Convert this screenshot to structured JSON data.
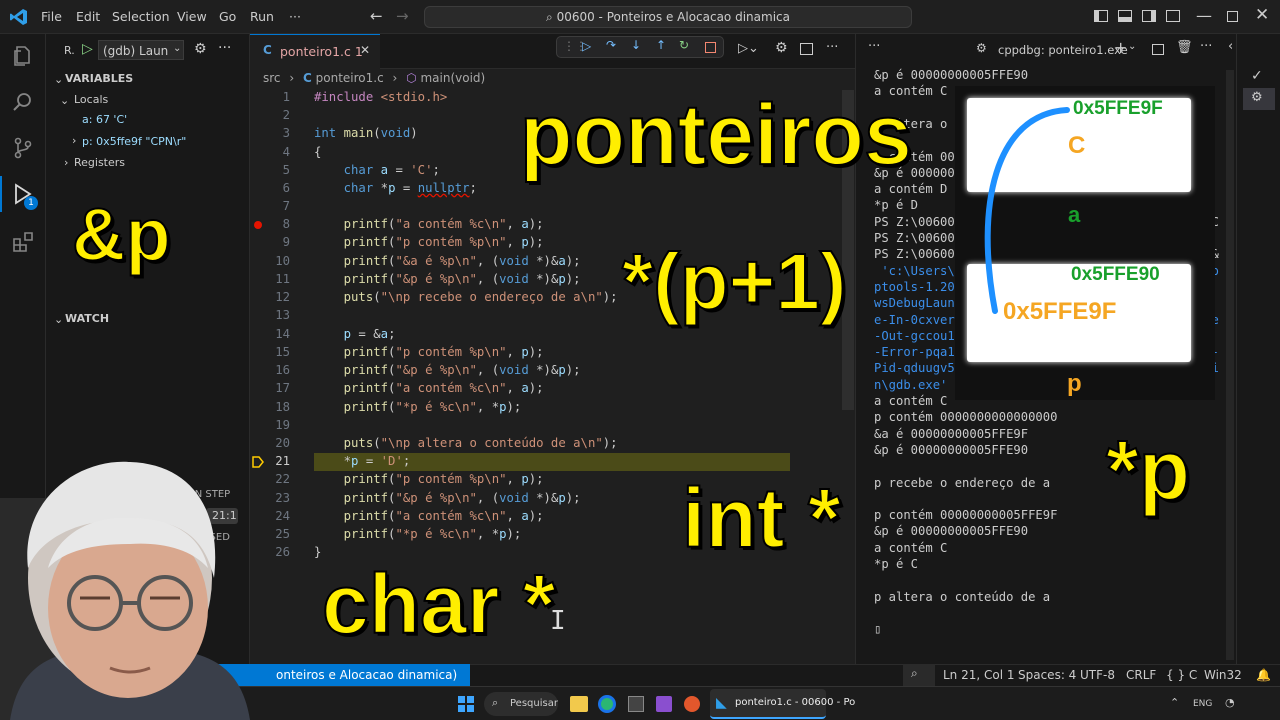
{
  "titlebar": {
    "menus": [
      "File",
      "Edit",
      "Selection",
      "View",
      "Go",
      "Run",
      "···"
    ],
    "command_center": "00600 - Ponteiros e Alocacao dinamica"
  },
  "sidebar": {
    "run_label": "R.",
    "config": "(gdb) Laun",
    "variables_title": "VARIABLES",
    "locals_label": "Locals",
    "var_a": "a: 67 'C'",
    "var_p": "p: 0x5ffe9f \"CPN\\r\"",
    "registers_label": "Registers",
    "watch_title": "WATCH",
    "callstack_state": "D ON STEP",
    "callstack_line": "21:1",
    "callstack_paused": "PAUSED"
  },
  "editor": {
    "tab_label": "ponteiro1.c 1",
    "breadcrumb_src": "src",
    "breadcrumb_file": "ponteiro1.c",
    "breadcrumb_symbol": "main(void)",
    "line_numbers": [
      "1",
      "2",
      "3",
      "4",
      "5",
      "6",
      "7",
      "8",
      "9",
      "10",
      "11",
      "12",
      "13",
      "14",
      "15",
      "16",
      "17",
      "18",
      "19",
      "20",
      "21",
      "22",
      "23",
      "24",
      "25",
      "26"
    ],
    "current_line": "21"
  },
  "terminal": {
    "tab_label": "cppdbg: ponteiro1.exe",
    "lines": [
      "&p é 00000000005FFE90",
      "a contém C",
      "",
      "p altera o c",
      "",
      "p contém 0000",
      "&p é 0000000",
      "a contém D",
      "*p é D",
      "PS Z:\\00600 - Ponteiros e Alocacao dinamica> ^C",
      "PS Z:\\00600 - Ponteiros e Alocacao dinamica>",
      "PS Z:\\00600 - Ponteiros e Alocacao dinamica>  &",
      " 'c:\\Users\\                                e.cp",
      "ptools-1.20.                              indo",
      "wsDebugLaunc                             ngine",
      "e-In-0cxverx                              ngine",
      "-Out-gccou1l                             ngine",
      "-Error-pqa12iy2.wl4' '--pid=Microsoft-MIEngine-",
      "Pid-qduugv5p.jjn' '--dbgExe=C:\\msys64\\ucrt64\\bi",
      "n\\gdb.exe' '--interpreter=mi'",
      "a contém C",
      "p contém 0000000000000000",
      "&a é 00000000005FFE9F",
      "&p é 00000000005FFE90",
      "",
      "p recebe o endereço de a",
      "",
      "p contém 00000000005FFE9F",
      "&p é 00000000005FFE90",
      "a contém C",
      "*p é C",
      "",
      "p altera o conteúdo de a",
      "",
      "▯"
    ]
  },
  "statusbar": {
    "folder": "onteiros e Alocacao dinamica)",
    "position": "Ln 21, Col 1",
    "spaces": "Spaces: 4",
    "encoding": "UTF-8",
    "eol": "CRLF",
    "language": "{ } C",
    "platform": "Win32"
  },
  "taskbar": {
    "search": "Pesquisar",
    "vscode_task": "ponteiro1.c - 00600 - Po",
    "lang": "ENG"
  },
  "overlay": {
    "title": "ponteiros",
    "amp_p": "&p",
    "p_plus_1": "*(p+1)",
    "int_star": "int *",
    "char_star": "char *",
    "star_p": "*p"
  },
  "diagram": {
    "addr_a": "0x5FFE9F",
    "value_a": "C",
    "label_a": "a",
    "addr_p": "0x5FFE90",
    "value_p": "0x5FFE9F",
    "label_p": "p",
    "colors": {
      "address": "#19a02c",
      "value": "#f5a623",
      "arrow": "#1e90ff"
    }
  },
  "colors": {
    "accent": "#0078d4",
    "overlay_yellow": "#ffee00"
  }
}
